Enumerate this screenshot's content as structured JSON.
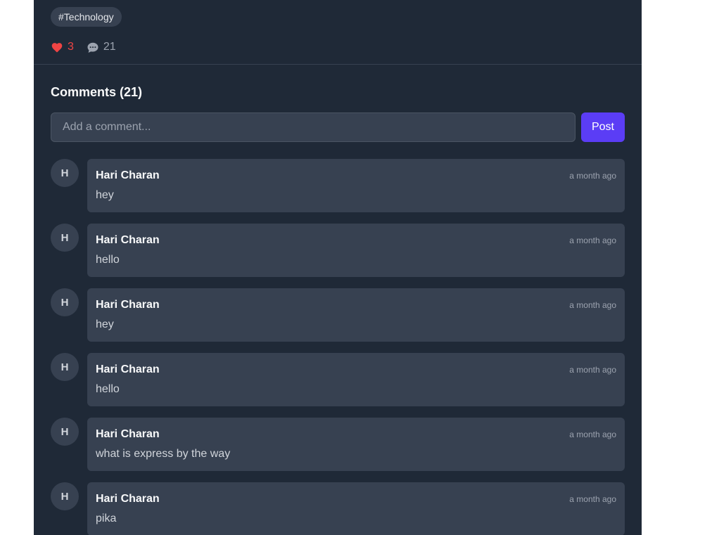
{
  "post": {
    "tag": "#Technology",
    "likes": "3",
    "comment_count": "21"
  },
  "comments_section": {
    "title": "Comments (21)",
    "input_placeholder": "Add a comment...",
    "post_button": "Post"
  },
  "comments": [
    {
      "initial": "H",
      "author": "Hari Charan",
      "time": "a month ago",
      "text": "hey"
    },
    {
      "initial": "H",
      "author": "Hari Charan",
      "time": "a month ago",
      "text": "hello"
    },
    {
      "initial": "H",
      "author": "Hari Charan",
      "time": "a month ago",
      "text": "hey"
    },
    {
      "initial": "H",
      "author": "Hari Charan",
      "time": "a month ago",
      "text": "hello"
    },
    {
      "initial": "H",
      "author": "Hari Charan",
      "time": "a month ago",
      "text": "what is express by the way"
    },
    {
      "initial": "H",
      "author": "Hari Charan",
      "time": "a month ago",
      "text": "pika"
    }
  ],
  "colors": {
    "panel_bg": "#1f2937",
    "card_bg": "#374151",
    "accent": "#5b3df5",
    "like": "#ef4444"
  },
  "icons": {
    "like": "heart-icon",
    "comments": "chat-bubble-icon"
  }
}
